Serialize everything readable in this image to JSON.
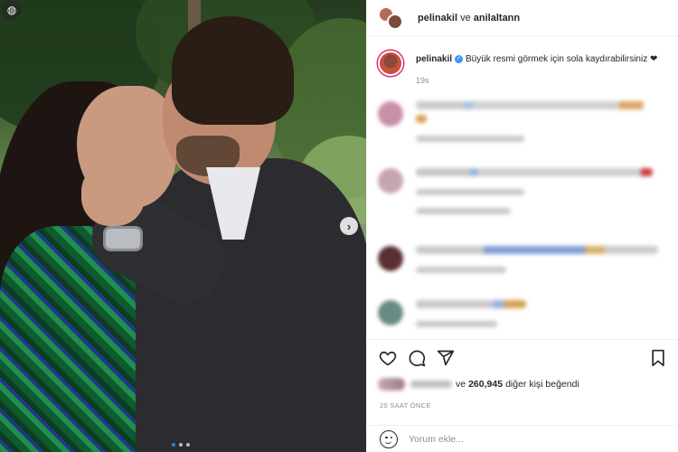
{
  "header": {
    "user1": "pelinakil",
    "connector": "ve",
    "user2": "anilaltann"
  },
  "caption": {
    "username": "pelinakil",
    "text": "Büyük resmi görmek için sola kaydırabilirsiniz ❤",
    "time": "19s"
  },
  "post": {
    "carousel_dots": 3,
    "active_dot": 1
  },
  "likes": {
    "prefix": "ve",
    "count": "260,945",
    "suffix": "diğer kişi beğendi"
  },
  "timestamp": "20 SAAT ÖNCE",
  "comment_input": {
    "placeholder": "Yorum ekle..."
  },
  "icons": [
    "heart-icon",
    "comment-icon",
    "share-icon",
    "bookmark-icon",
    "emoji-icon",
    "next-arrow-icon",
    "carousel-badge-icon"
  ]
}
